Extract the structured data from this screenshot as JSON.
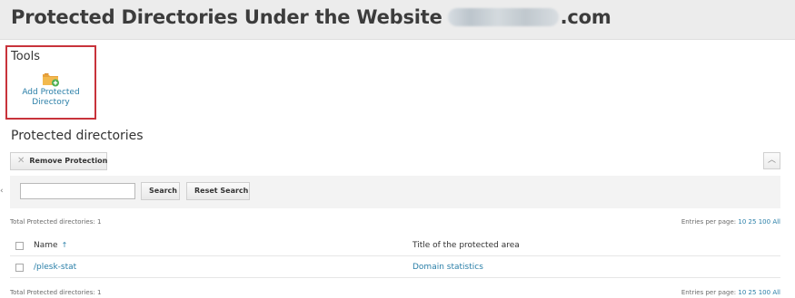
{
  "page": {
    "title_prefix": "Protected Directories Under the Website",
    "title_suffix": ".com"
  },
  "tools": {
    "label": "Tools",
    "add_protected_directory": {
      "line1": "Add Protected",
      "line2": "Directory",
      "icon": "folder-add-icon"
    }
  },
  "section": {
    "title": "Protected directories"
  },
  "toolbar": {
    "remove_protection": "Remove Protection",
    "remove_icon": "✕",
    "collapse_icon": "︿"
  },
  "search": {
    "value": "",
    "placeholder": "",
    "search_label": "Search",
    "reset_label": "Reset Search"
  },
  "summary": {
    "total_text": "Total Protected directories: 1",
    "entries_label": "Entries per page:",
    "entries_options": [
      "10",
      "25",
      "100",
      "All"
    ]
  },
  "table": {
    "columns": {
      "name": "Name",
      "sort_indicator": "↑",
      "title": "Title of the protected area"
    },
    "rows": [
      {
        "name": "/plesk-stat",
        "title": "Domain statistics"
      }
    ]
  },
  "side_handle": "‹",
  "colors": {
    "accent_link": "#2a7fa8",
    "highlight_border": "#c8333b",
    "header_bg": "#ececec"
  }
}
